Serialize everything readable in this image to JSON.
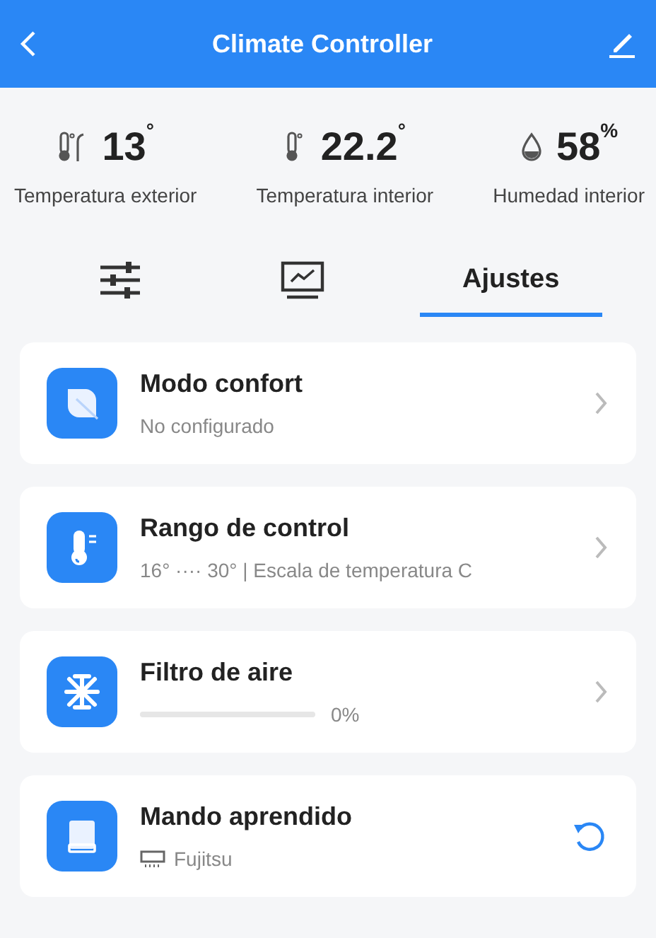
{
  "header": {
    "title": "Climate Controller"
  },
  "stats": [
    {
      "value": "13",
      "unit": "°",
      "label": "Temperatura exterior"
    },
    {
      "value": "22.2",
      "unit": "°",
      "label": "Temperatura interior"
    },
    {
      "value": "58",
      "unit": "%",
      "label": "Humedad interior"
    }
  ],
  "tabs": [
    {
      "selected": false
    },
    {
      "selected": false
    },
    {
      "label": "Ajustes",
      "selected": true
    }
  ],
  "cards": [
    {
      "kind": "link",
      "title": "Modo confort",
      "subtitle": "No configurado"
    },
    {
      "kind": "link",
      "title": "Rango de control",
      "subtitle": "16° ···· 30° | Escala de temperatura C"
    },
    {
      "kind": "progress",
      "title": "Filtro de aire",
      "level": 0,
      "reading": "0%"
    },
    {
      "kind": "device",
      "title": "Mando aprendido",
      "subtitle": "Fujitsu"
    }
  ]
}
